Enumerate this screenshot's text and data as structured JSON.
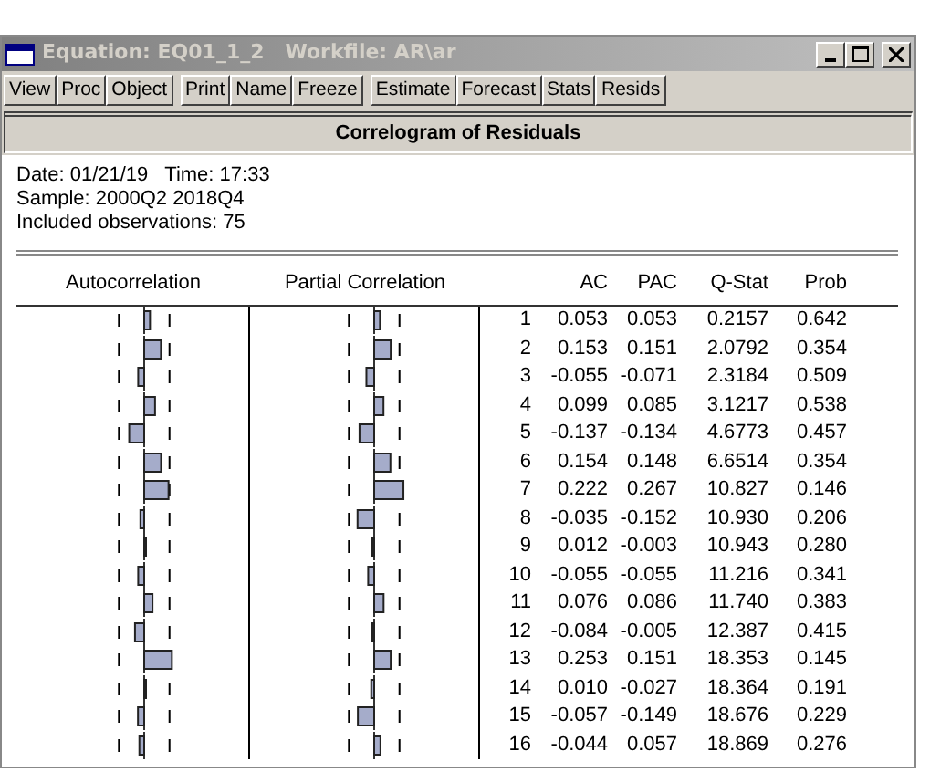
{
  "window": {
    "title": "Equation: EQ01_1_2   Workfile: AR\\ar"
  },
  "toolbar": [
    [
      "View",
      "Proc",
      "Object"
    ],
    [
      "Print",
      "Name",
      "Freeze"
    ],
    [
      "Estimate",
      "Forecast",
      "Stats",
      "Resids"
    ]
  ],
  "view_title": "Correlogram of Residuals",
  "info": [
    "Date: 01/21/19   Time: 17:33",
    "Sample: 2000Q2 2018Q4",
    "Included observations: 75"
  ],
  "table": {
    "headers": {
      "autocorrelation": "Autocorrelation",
      "partial_correlation": "Partial Correlation",
      "ac": "AC",
      "pac": "PAC",
      "q_stat": "Q-Stat",
      "prob": "Prob"
    },
    "rows": [
      {
        "lag": "1",
        "ac": "0.053",
        "pac": "0.053",
        "q_stat": "0.2157",
        "prob": "0.642"
      },
      {
        "lag": "2",
        "ac": "0.153",
        "pac": "0.151",
        "q_stat": "2.0792",
        "prob": "0.354"
      },
      {
        "lag": "3",
        "ac": "-0.055",
        "pac": "-0.071",
        "q_stat": "2.3184",
        "prob": "0.509"
      },
      {
        "lag": "4",
        "ac": "0.099",
        "pac": "0.085",
        "q_stat": "3.1217",
        "prob": "0.538"
      },
      {
        "lag": "5",
        "ac": "-0.137",
        "pac": "-0.134",
        "q_stat": "4.6773",
        "prob": "0.457"
      },
      {
        "lag": "6",
        "ac": "0.154",
        "pac": "0.148",
        "q_stat": "6.6514",
        "prob": "0.354"
      },
      {
        "lag": "7",
        "ac": "0.222",
        "pac": "0.267",
        "q_stat": "10.827",
        "prob": "0.146"
      },
      {
        "lag": "8",
        "ac": "-0.035",
        "pac": "-0.152",
        "q_stat": "10.930",
        "prob": "0.206"
      },
      {
        "lag": "9",
        "ac": "0.012",
        "pac": "-0.003",
        "q_stat": "10.943",
        "prob": "0.280"
      },
      {
        "lag": "10",
        "ac": "-0.055",
        "pac": "-0.055",
        "q_stat": "11.216",
        "prob": "0.341"
      },
      {
        "lag": "11",
        "ac": "0.076",
        "pac": "0.086",
        "q_stat": "11.740",
        "prob": "0.383"
      },
      {
        "lag": "12",
        "ac": "-0.084",
        "pac": "-0.005",
        "q_stat": "12.387",
        "prob": "0.415"
      },
      {
        "lag": "13",
        "ac": "0.253",
        "pac": "0.151",
        "q_stat": "18.353",
        "prob": "0.145"
      },
      {
        "lag": "14",
        "ac": "0.010",
        "pac": "-0.027",
        "q_stat": "18.364",
        "prob": "0.191"
      },
      {
        "lag": "15",
        "ac": "-0.057",
        "pac": "-0.149",
        "q_stat": "18.676",
        "prob": "0.229"
      },
      {
        "lag": "16",
        "ac": "-0.044",
        "pac": "0.057",
        "q_stat": "18.869",
        "prob": "0.276"
      }
    ]
  }
}
